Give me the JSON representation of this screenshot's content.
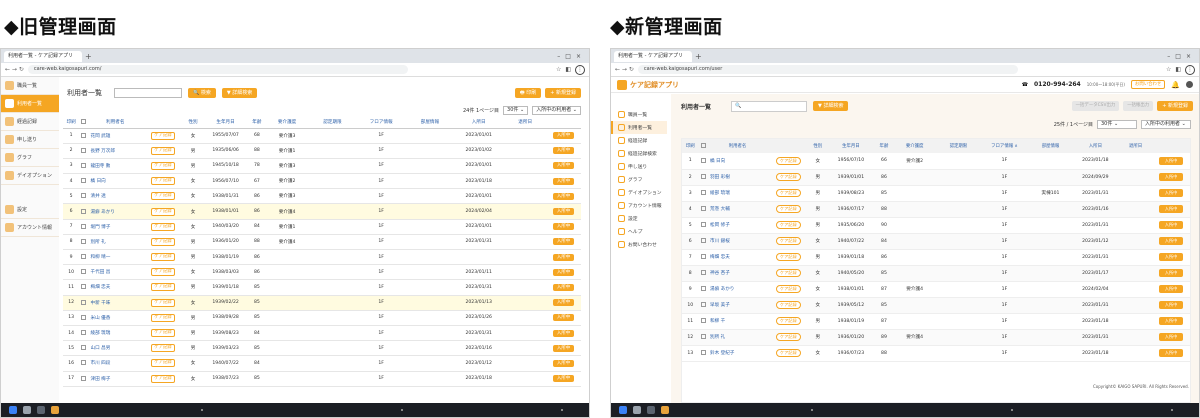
{
  "headings": {
    "old": "◆旧管理画面",
    "new": "◆新管理画面"
  },
  "browser": {
    "tab_label": "利用者一覧 - ケア記録アプリ",
    "old_url": "care-web.kaigosapuri.com/",
    "new_url": "care-web.kaigosapuri.com/user"
  },
  "old": {
    "sidebar": [
      {
        "label": "職員一覧",
        "active": false
      },
      {
        "label": "利用者一覧",
        "active": true
      },
      {
        "label": "経過記録",
        "active": false
      },
      {
        "label": "申し送り",
        "active": false
      },
      {
        "label": "グラフ",
        "active": false
      },
      {
        "label": "デイオプション",
        "active": false
      },
      {
        "label": "設定",
        "active": false,
        "gap": true
      },
      {
        "label": "アカウント情報",
        "active": false
      }
    ],
    "page_title": "利用者一覧",
    "search_button": "検索",
    "detail_search_button": "詳細検索",
    "print_button": "印刷",
    "new_register_button": "新規登録",
    "page_info": "24件 1ページ目",
    "per_page": "30件",
    "filter": "入所中の利用者",
    "columns": [
      "印刷",
      "",
      "利用者名",
      "",
      "性別",
      "生年月日",
      "年齢",
      "要介護度",
      "認定期限",
      "フロア情報",
      "部屋情報",
      "入所日",
      "退所日",
      ""
    ],
    "care_label": "ケア記録",
    "in_label": "入所中",
    "rows": [
      {
        "no": "1",
        "name": "花岡 武雄",
        "sex": "女",
        "birth": "1955/07/07",
        "age": "68",
        "care": "要介護3",
        "floor": "1F",
        "room": "",
        "date": "2023/01/01",
        "hl": false
      },
      {
        "no": "2",
        "name": "長野 万次郎",
        "sex": "男",
        "birth": "1935/06/06",
        "age": "88",
        "care": "要介護1",
        "floor": "1F",
        "room": "",
        "date": "2023/01/02",
        "hl": false
      },
      {
        "no": "3",
        "name": "龍田寺 勲",
        "sex": "男",
        "birth": "1945/10/18",
        "age": "78",
        "care": "要介護3",
        "floor": "1F",
        "room": "",
        "date": "2023/01/01",
        "hl": false
      },
      {
        "no": "4",
        "name": "橘 日向",
        "sex": "女",
        "birth": "1956/07/10",
        "age": "67",
        "care": "要介護2",
        "floor": "1F",
        "room": "",
        "date": "2023/01/18",
        "hl": false
      },
      {
        "no": "5",
        "name": "清井 透",
        "sex": "女",
        "birth": "1938/01/31",
        "age": "86",
        "care": "要介護3",
        "floor": "1F",
        "room": "",
        "date": "2023/01/01",
        "hl": false
      },
      {
        "no": "6",
        "name": "湯癖 あかり",
        "sex": "女",
        "birth": "1938/01/01",
        "age": "86",
        "care": "要介護4",
        "floor": "1F",
        "room": "",
        "date": "2024/02/04",
        "hl": true
      },
      {
        "no": "7",
        "name": "堀門 博子",
        "sex": "女",
        "birth": "1940/03/20",
        "age": "84",
        "care": "要介護1",
        "floor": "1F",
        "room": "",
        "date": "2023/01/01",
        "hl": false
      },
      {
        "no": "8",
        "name": "別所 礼",
        "sex": "男",
        "birth": "1936/01/20",
        "age": "88",
        "care": "要介護4",
        "floor": "1F",
        "room": "",
        "date": "2023/01/31",
        "hl": false
      },
      {
        "no": "9",
        "name": "和柳 晴一",
        "sex": "男",
        "birth": "1938/01/19",
        "age": "86",
        "care": "",
        "floor": "1F",
        "room": "",
        "date": "",
        "hl": false
      },
      {
        "no": "10",
        "name": "千代田 昌",
        "sex": "女",
        "birth": "1938/03/03",
        "age": "86",
        "care": "",
        "floor": "1F",
        "room": "",
        "date": "2023/01/11",
        "hl": false
      },
      {
        "no": "11",
        "name": "梅畑 忠夫",
        "sex": "男",
        "birth": "1939/01/18",
        "age": "85",
        "care": "",
        "floor": "1F",
        "room": "",
        "date": "2023/01/31",
        "hl": false
      },
      {
        "no": "12",
        "name": "中新 千味",
        "sex": "女",
        "birth": "1939/02/22",
        "age": "85",
        "care": "",
        "floor": "1F",
        "room": "",
        "date": "2023/01/13",
        "hl": true
      },
      {
        "no": "13",
        "name": "米山 優香",
        "sex": "男",
        "birth": "1938/09/28",
        "age": "85",
        "care": "",
        "floor": "1F",
        "room": "",
        "date": "2023/01/26",
        "hl": false
      },
      {
        "no": "14",
        "name": "綾部 琉瑞",
        "sex": "男",
        "birth": "1939/08/23",
        "age": "84",
        "care": "",
        "floor": "1F",
        "room": "",
        "date": "2023/01/31",
        "hl": false
      },
      {
        "no": "15",
        "name": "山口 昌男",
        "sex": "男",
        "birth": "1939/03/23",
        "age": "85",
        "care": "",
        "floor": "1F",
        "room": "",
        "date": "2023/01/16",
        "hl": false
      },
      {
        "no": "16",
        "name": "市川 四段",
        "sex": "女",
        "birth": "1940/07/22",
        "age": "84",
        "care": "",
        "floor": "1F",
        "room": "",
        "date": "2023/01/12",
        "hl": false
      },
      {
        "no": "17",
        "name": "津田 梅子",
        "sex": "女",
        "birth": "1938/07/23",
        "age": "85",
        "care": "",
        "floor": "1F",
        "room": "",
        "date": "2023/01/18",
        "hl": false
      }
    ]
  },
  "new": {
    "app_name": "ケア記録アプリ",
    "phone": "0120-994-264",
    "phone_hours": "10:00〜18:00(平日)",
    "header_button": "お問い合わせ",
    "sidebar": [
      {
        "label": "職員一覧",
        "active": false
      },
      {
        "label": "利用者一覧",
        "active": true
      },
      {
        "label": "経過記録",
        "active": false
      },
      {
        "label": "経過記録検索",
        "active": false
      },
      {
        "label": "申し送り",
        "active": false
      },
      {
        "label": "グラフ",
        "active": false
      },
      {
        "label": "デイオプション",
        "active": false
      },
      {
        "label": "アカウント情報",
        "active": false
      },
      {
        "label": "設定",
        "active": false
      },
      {
        "label": "ヘルプ",
        "active": false
      },
      {
        "label": "お問い合わせ",
        "active": false
      }
    ],
    "page_title": "利用者一覧",
    "detail_search_button": "詳細検索",
    "disabled_btn_1": "一括データCSV出力",
    "disabled_btn_2": "一括帳出力",
    "new_register_button": "新規登録",
    "page_info": "25件 / 1ページ目",
    "per_page": "30件",
    "filter": "入所中の利用者",
    "columns": [
      "印刷",
      "",
      "利用者名",
      "",
      "性別",
      "生年月日",
      "年齢",
      "要介護度",
      "認定期限",
      "フロア情報 ∧",
      "部屋情報",
      "入所日",
      "退所日",
      ""
    ],
    "care_label": "ケア記録",
    "in_label": "入所中",
    "rows": [
      {
        "no": "1",
        "name": "橘 日向",
        "sex": "女",
        "birth": "1956/07/10",
        "age": "66",
        "care": "要介護2",
        "floor": "1F",
        "room": "",
        "date": "2023/01/18"
      },
      {
        "no": "2",
        "name": "羽田 彩樹",
        "sex": "男",
        "birth": "1939/01/01",
        "age": "86",
        "care": "",
        "floor": "1F",
        "room": "",
        "date": "2024/09/29"
      },
      {
        "no": "3",
        "name": "綾部 琉瑞",
        "sex": "男",
        "birth": "1939/08/23",
        "age": "85",
        "care": "",
        "floor": "1F",
        "room": "実棟101",
        "date": "2023/01/31"
      },
      {
        "no": "4",
        "name": "荒巻 大輔",
        "sex": "男",
        "birth": "1936/07/17",
        "age": "88",
        "care": "",
        "floor": "1F",
        "room": "",
        "date": "2023/01/16"
      },
      {
        "no": "5",
        "name": "松岡 修子",
        "sex": "男",
        "birth": "1935/06/20",
        "age": "90",
        "care": "",
        "floor": "1F",
        "room": "",
        "date": "2023/01/31"
      },
      {
        "no": "6",
        "name": "市川 銀桜",
        "sex": "女",
        "birth": "1940/07/22",
        "age": "84",
        "care": "",
        "floor": "1F",
        "room": "",
        "date": "2023/01/12"
      },
      {
        "no": "7",
        "name": "梅畑 忠夫",
        "sex": "男",
        "birth": "1939/01/18",
        "age": "86",
        "care": "",
        "floor": "1F",
        "room": "",
        "date": "2023/01/31"
      },
      {
        "no": "8",
        "name": "神谷 杏子",
        "sex": "女",
        "birth": "1940/05/20",
        "age": "85",
        "care": "",
        "floor": "1F",
        "room": "",
        "date": "2023/01/17"
      },
      {
        "no": "9",
        "name": "湯癖 あかり",
        "sex": "女",
        "birth": "1938/01/01",
        "age": "87",
        "care": "要介護4",
        "floor": "1F",
        "room": "",
        "date": "2024/02/04"
      },
      {
        "no": "10",
        "name": "早坂 美子",
        "sex": "女",
        "birth": "1939/05/12",
        "age": "85",
        "care": "",
        "floor": "1F",
        "room": "",
        "date": "2023/01/31"
      },
      {
        "no": "11",
        "name": "和柳 千",
        "sex": "男",
        "birth": "1938/01/19",
        "age": "87",
        "care": "",
        "floor": "1F",
        "room": "",
        "date": "2023/01/18"
      },
      {
        "no": "12",
        "name": "別所 礼",
        "sex": "男",
        "birth": "1936/01/20",
        "age": "89",
        "care": "要介護4",
        "floor": "1F",
        "room": "",
        "date": "2023/01/31"
      },
      {
        "no": "13",
        "name": "鈴木 登紀子",
        "sex": "女",
        "birth": "1936/07/23",
        "age": "88",
        "care": "",
        "floor": "1F",
        "room": "",
        "date": "2023/01/18"
      }
    ],
    "footer": "Copyright© KAIGO SAPURI. All Rights Reserved."
  }
}
